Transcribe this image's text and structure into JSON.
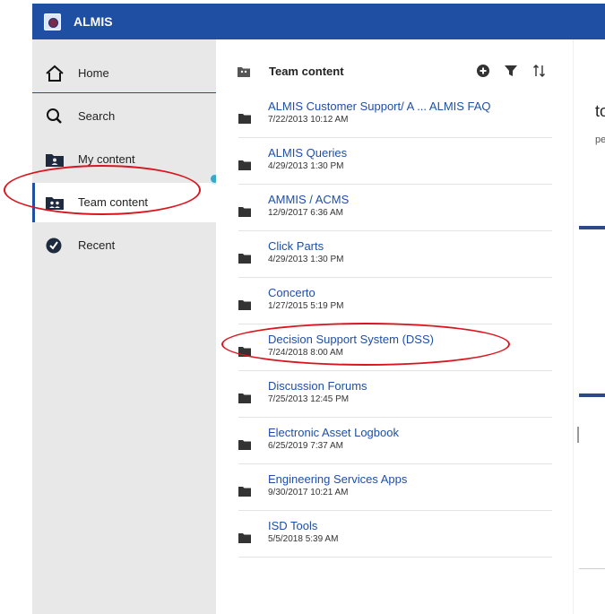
{
  "app": {
    "title": "ALMIS",
    "logo_icon": "seal-logo-icon"
  },
  "colors": {
    "accent": "#1f4fa3",
    "annotation": "#d9161f",
    "indicator": "#3aa7c9"
  },
  "sidebar": {
    "items": [
      {
        "label": "Home",
        "icon": "home-icon"
      },
      {
        "label": "Search",
        "icon": "search-icon"
      },
      {
        "label": "My content",
        "icon": "user-folder-icon"
      },
      {
        "label": "Team content",
        "icon": "team-folder-icon",
        "selected": true
      },
      {
        "label": "Recent",
        "icon": "clock-icon"
      }
    ]
  },
  "panel": {
    "title": "Team content",
    "actions": [
      "add-icon",
      "filter-icon",
      "sort-icon"
    ],
    "items": [
      {
        "name": "ALMIS Customer Support/ A ... ALMIS FAQ",
        "date": "7/22/2013 10:12 AM"
      },
      {
        "name": "ALMIS Queries",
        "date": "4/29/2013 1:30 PM"
      },
      {
        "name": "AMMIS / ACMS",
        "date": "12/9/2017 6:36 AM"
      },
      {
        "name": "Click Parts",
        "date": "4/29/2013 1:30 PM"
      },
      {
        "name": "Concerto",
        "date": "1/27/2015 5:19 PM"
      },
      {
        "name": "Decision Support System (DSS)",
        "date": "7/24/2018 8:00 AM"
      },
      {
        "name": "Discussion Forums",
        "date": "7/25/2013 12:45 PM"
      },
      {
        "name": "Electronic Asset Logbook",
        "date": "6/25/2019 7:37 AM"
      },
      {
        "name": "Engineering Services Apps",
        "date": "9/30/2017 10:21 AM"
      },
      {
        "name": "ISD Tools",
        "date": "5/5/2018 5:39 AM"
      }
    ]
  },
  "right_panel": {
    "heading_fragment": "to",
    "text_fragment": "pen"
  }
}
